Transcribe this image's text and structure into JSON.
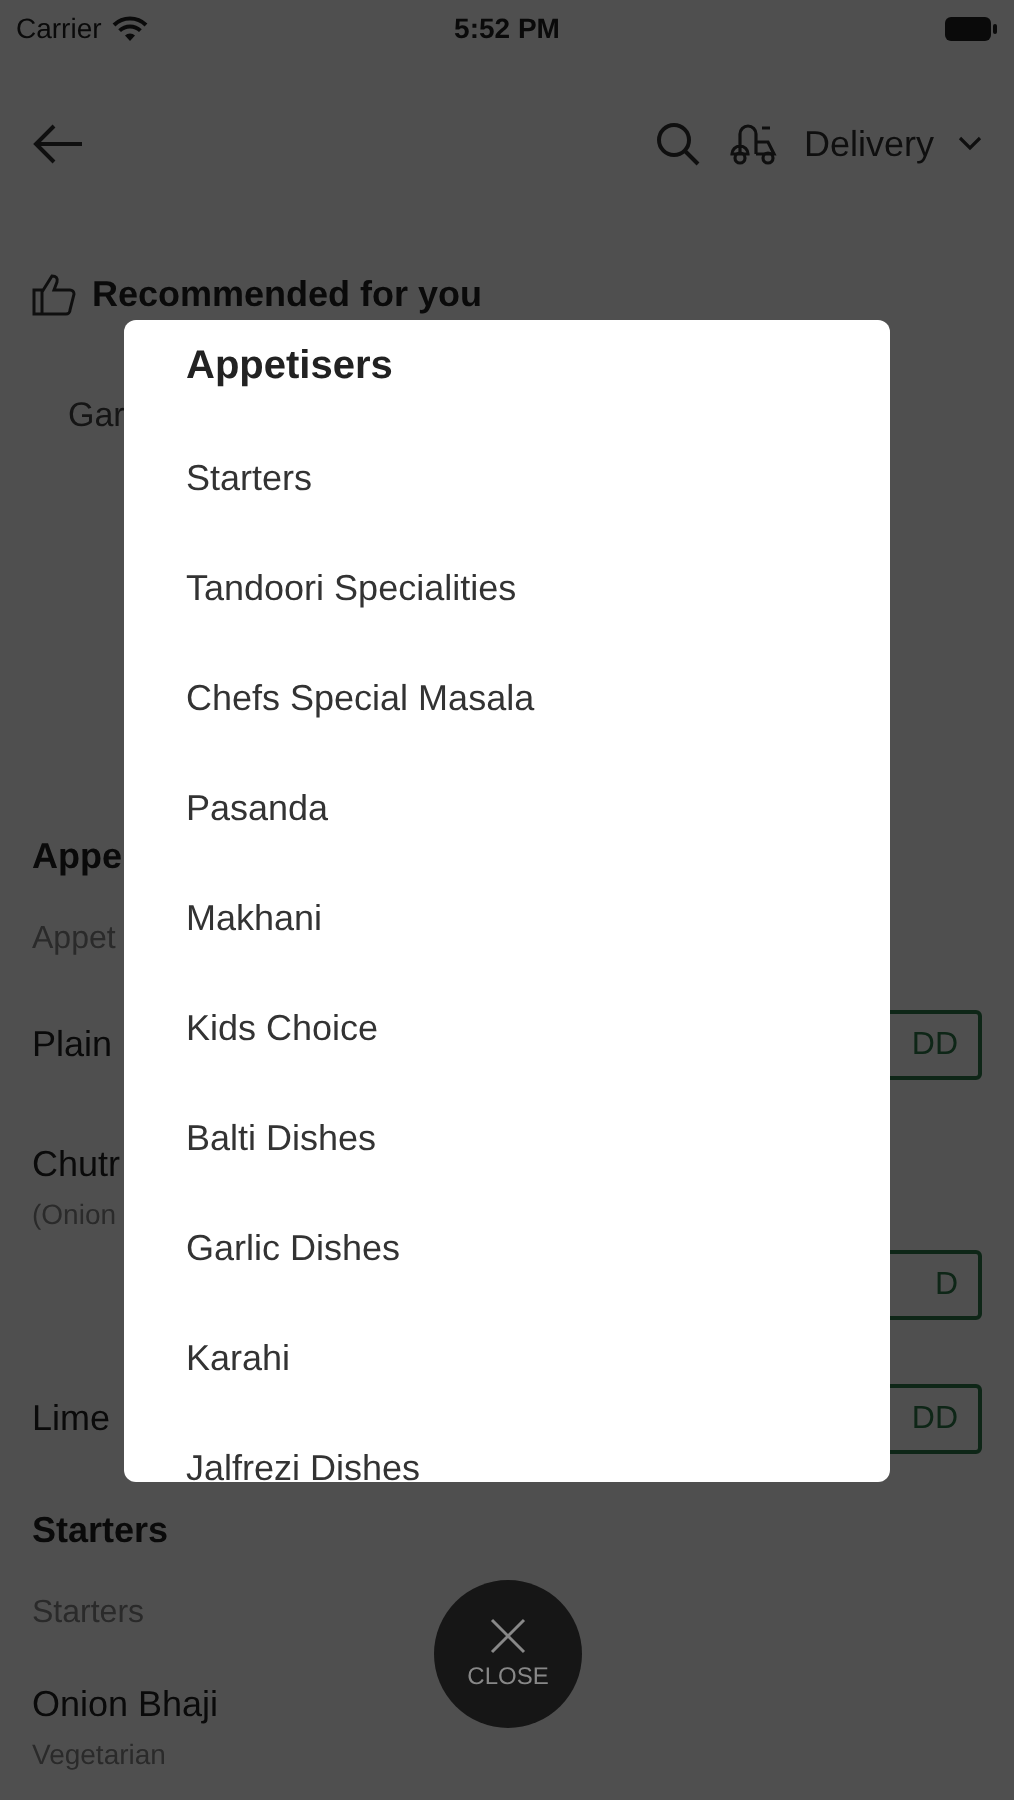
{
  "status_bar": {
    "carrier": "Carrier",
    "time": "5:52 PM"
  },
  "header": {
    "delivery_mode": "Delivery"
  },
  "recommended": {
    "title": "Recommended for you",
    "items": [
      "Gar"
    ]
  },
  "menu_sections": [
    {
      "title": "Appe",
      "subtitle": "Appet",
      "items": [
        {
          "name": "Plain",
          "button": "DD"
        },
        {
          "name": "Chutr",
          "note": "(Onion",
          "button": "D"
        },
        {
          "name": "Lime",
          "button": "DD"
        }
      ]
    },
    {
      "title": "Starters",
      "subtitle": "Starters",
      "items": [
        {
          "name": "Onion Bhaji",
          "note": "Vegetarian"
        }
      ]
    }
  ],
  "modal": {
    "title": "Appetisers",
    "items": [
      "Starters",
      "Tandoori Specialities",
      "Chefs Special Masala",
      "Pasanda",
      "Makhani",
      "Kids Choice",
      "Balti Dishes",
      "Garlic Dishes",
      "Karahi",
      "Jalfrezi Dishes"
    ]
  },
  "close_button": {
    "label": "CLOSE"
  }
}
